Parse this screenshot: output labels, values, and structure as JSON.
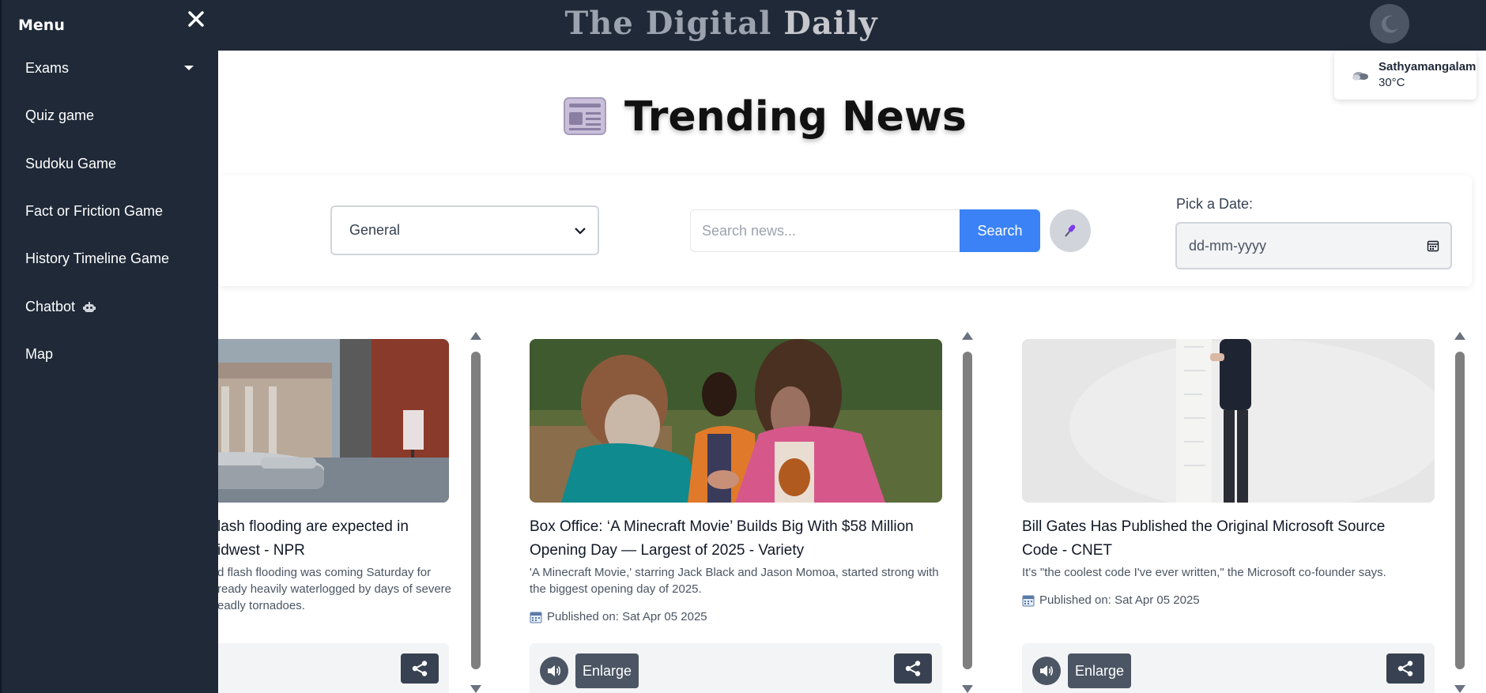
{
  "header": {
    "site_title_dark": "The Digital",
    "site_title_light": "Daily",
    "theme_icon": "moon-icon"
  },
  "weather": {
    "icon": "cloud-icon",
    "city": "Sathyamangalam",
    "temp": "30°C"
  },
  "main": {
    "heading": "Trending News",
    "heading_icon": "newspaper-icon"
  },
  "filters": {
    "category_selected": "General",
    "search_placeholder": "Search news...",
    "search_button": "Search",
    "mic_icon": "microphone-icon",
    "date_label": "Pick a Date:",
    "date_placeholder": "dd-mm-yyyy"
  },
  "articles": [
    {
      "title_line1": "lash flooding are expected in",
      "title_line2": "idwest - NPR",
      "desc_line1": "d flash flooding was coming Saturday for",
      "desc_line2": "ready heavily waterlogged by days of severe",
      "desc_line3": "eadly tornadoes."
    },
    {
      "title_line1": "Box Office: ‘A Minecraft Movie’ Builds Big With $58 Million",
      "title_line2": "Opening Day — Largest of 2025 - Variety",
      "desc_line1": "'A Minecraft Movie,' starring Jack Black and Jason Momoa, started strong with",
      "desc_line2": "the biggest opening day of 2025.",
      "published": "Published on: Sat Apr 05 2025",
      "enlarge": "Enlarge"
    },
    {
      "title_line1": "Bill Gates Has Published the Original Microsoft Source",
      "title_line2": "Code - CNET",
      "desc_line1": "It's \"the coolest code I've ever written,\" the Microsoft co-founder says.",
      "published": "Published on: Sat Apr 05 2025",
      "enlarge": "Enlarge"
    }
  ],
  "sidemenu": {
    "title": "Menu",
    "items": [
      {
        "label": "Exams"
      },
      {
        "label": "Quiz game"
      },
      {
        "label": "Sudoku Game"
      },
      {
        "label": "Fact or Friction Game"
      },
      {
        "label": "History Timeline Game"
      },
      {
        "label": "Chatbot"
      },
      {
        "label": "Map"
      }
    ]
  },
  "colors": {
    "navbar": "#1f2937",
    "accent_blue": "#3b82f6",
    "button_gray": "#4b5563"
  }
}
